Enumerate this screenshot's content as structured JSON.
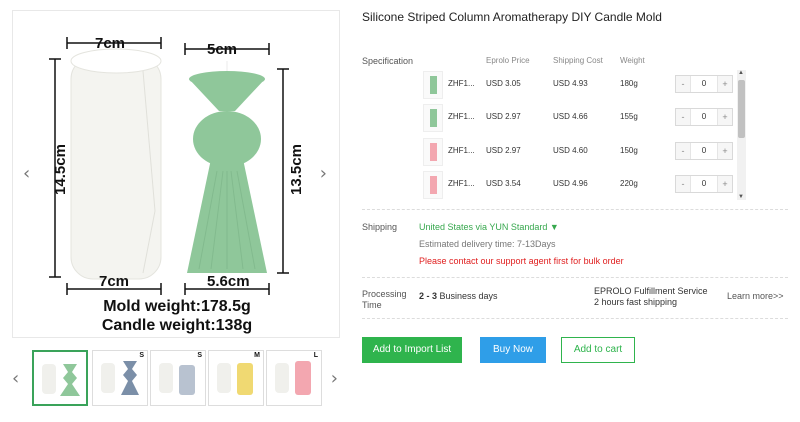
{
  "gallery": {
    "main": {
      "dims": {
        "top_left": "7cm",
        "top_right": "5cm",
        "height_left": "14.5cm",
        "height_right": "13.5cm",
        "bottom_left": "7cm",
        "bottom_right": "5.6cm"
      },
      "mold_weight": "Mold weight:178.5g",
      "candle_weight": "Candle weight:138g",
      "colors": {
        "mold": "#f2f2ee",
        "candle": "#8fc79a"
      }
    },
    "prev_icon": "‹",
    "next_icon": "›",
    "thumbnails": [
      {
        "tag": "",
        "color": "#8fc79a"
      },
      {
        "tag": "S",
        "color": "#7b8fa8"
      },
      {
        "tag": "S",
        "color": "#b8c2d0"
      },
      {
        "tag": "M",
        "color": "#f0d972"
      },
      {
        "tag": "L",
        "color": "#f3a7b0"
      }
    ]
  },
  "product": {
    "title": "Silicone Striped Column Aromatherapy DIY Candle Mold"
  },
  "spec": {
    "label": "Specification",
    "columns": {
      "price": "Eprolo Price",
      "shipping": "Shipping Cost",
      "weight": "Weight"
    },
    "rows": [
      {
        "sku": "ZHF1...",
        "price": "USD 3.05",
        "shipping": "USD 4.93",
        "weight": "180g",
        "qty": "0",
        "color": "#8fc79a"
      },
      {
        "sku": "ZHF1...",
        "price": "USD 2.97",
        "shipping": "USD 4.66",
        "weight": "155g",
        "qty": "0",
        "color": "#8fc79a"
      },
      {
        "sku": "ZHF1...",
        "price": "USD 2.97",
        "shipping": "USD 4.60",
        "weight": "150g",
        "qty": "0",
        "color": "#f3a7b0"
      },
      {
        "sku": "ZHF1...",
        "price": "USD 3.54",
        "shipping": "USD 4.96",
        "weight": "220g",
        "qty": "0",
        "color": "#f3a7b0"
      }
    ],
    "minus": "-",
    "plus": "+"
  },
  "shipping": {
    "label": "Shipping",
    "method": "United States via YUN Standard ▼",
    "estimate": "Estimated delivery time: 7-13Days",
    "warning": "Please contact our support agent first for bulk order"
  },
  "processing": {
    "label": "Processing Time",
    "days_range": "2 - 3",
    "days_suffix": " Business days",
    "fulfillment_line1": "EPROLO Fulfillment Service",
    "fulfillment_line2": "2 hours fast shipping",
    "learn_more": "Learn more>>"
  },
  "actions": {
    "import": "Add to Import List",
    "buy": "Buy Now",
    "cart": "Add to cart"
  }
}
